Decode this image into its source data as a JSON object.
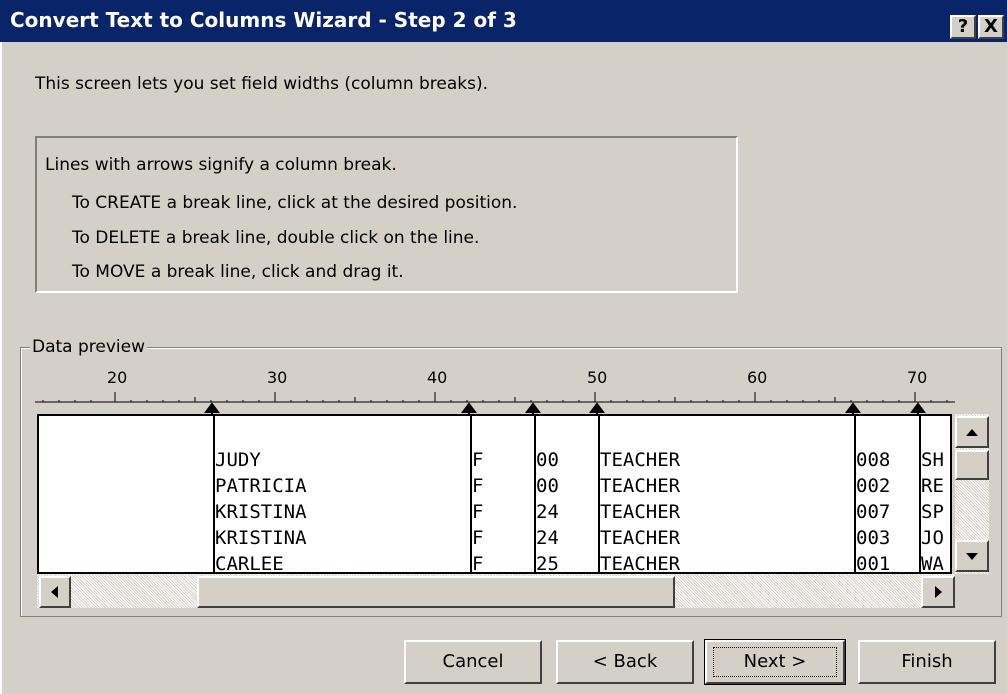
{
  "window": {
    "title": "Convert Text to Columns Wizard - Step 2 of 3",
    "help_label": "?",
    "close_label": "X"
  },
  "intro_text": "This screen lets you set field widths (column breaks).",
  "info": {
    "line1": "Lines with arrows signify a column break.",
    "line2": "To CREATE a break line, click at the desired position.",
    "line3": "To DELETE a break line, double click on the line.",
    "line4": "To MOVE a break line, click and drag it."
  },
  "preview": {
    "label": "Data preview",
    "ruler_labels": [
      "20",
      "30",
      "40",
      "50",
      "60",
      "70"
    ],
    "rows": [
      [
        "JUDY",
        "F",
        "00",
        "TEACHER",
        "008",
        "SH"
      ],
      [
        "PATRICIA",
        "F",
        "00",
        "TEACHER",
        "002",
        "RE"
      ],
      [
        "KRISTINA",
        "F",
        "24",
        "TEACHER",
        "007",
        "SP"
      ],
      [
        "KRISTINA",
        "F",
        "24",
        "TEACHER",
        "003",
        "JO"
      ],
      [
        "CARLEE",
        "F",
        "25",
        "TEACHER",
        "001",
        "WA"
      ]
    ]
  },
  "icons": {
    "scroll_up": "up-arrow-icon",
    "scroll_down": "down-arrow-icon",
    "scroll_left": "left-arrow-icon",
    "scroll_right": "right-arrow-icon"
  },
  "buttons": {
    "cancel": "Cancel",
    "back": "< Back",
    "next": "Next >",
    "finish": "Finish"
  },
  "colors": {
    "titlebar": "#0a246a",
    "face": "#d4d0c8"
  }
}
